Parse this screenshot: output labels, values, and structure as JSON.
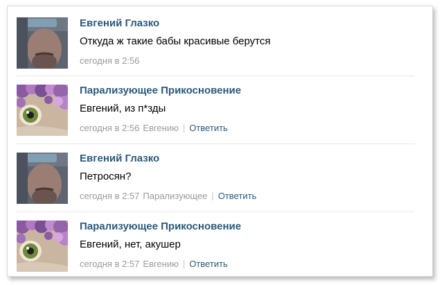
{
  "comments": [
    {
      "author": "Евгений Глазко",
      "text": "Откуда ж такие бабы красивые берутся",
      "time": "сегодня в 2:56",
      "reply_to": "",
      "reply_label": "",
      "avatar": "avatar-man"
    },
    {
      "author": "Парализующее Прикосновение",
      "text": "Евгений, из п*зды",
      "time": "сегодня в 2:56",
      "reply_to": "Евгению",
      "reply_label": "Ответить",
      "avatar": "avatar-flowers-eye"
    },
    {
      "author": "Евгений Глазко",
      "text": "Петросян?",
      "time": "сегодня в 2:57",
      "reply_to": "Парализующее",
      "reply_label": "Ответить",
      "avatar": "avatar-man"
    },
    {
      "author": "Парализующее Прикосновение",
      "text": "Евгений, нет, акушер",
      "time": "сегодня в 2:57",
      "reply_to": "Евгению",
      "reply_label": "Ответить",
      "avatar": "avatar-flowers-eye"
    }
  ],
  "colors": {
    "author_link": "#2b587a",
    "meta_text": "#999999",
    "divider": "#e3e6ea"
  }
}
